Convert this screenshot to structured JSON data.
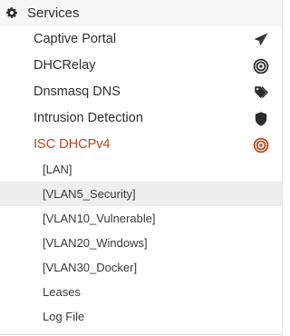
{
  "section": {
    "label": "Services",
    "icon": "gear-icon"
  },
  "items": [
    {
      "label": "Captive Portal",
      "icon": "paper-plane-icon"
    },
    {
      "label": "DHCRelay",
      "icon": "target-icon"
    },
    {
      "label": "Dnsmasq DNS",
      "icon": "tags-icon"
    },
    {
      "label": "Intrusion Detection",
      "icon": "shield-icon"
    },
    {
      "label": "ISC DHCPv4",
      "icon": "target-icon",
      "active": true
    }
  ],
  "subitems": [
    {
      "label": "[LAN]"
    },
    {
      "label": "[VLAN5_Security]",
      "highlight": true
    },
    {
      "label": "[VLAN10_Vulnerable]"
    },
    {
      "label": "[VLAN20_Windows]"
    },
    {
      "label": "[VLAN30_Docker]"
    },
    {
      "label": "Leases"
    },
    {
      "label": "Log File"
    }
  ],
  "colors": {
    "accent": "#c0471d",
    "text": "#2f2f2f",
    "icon": "#2d2d2d",
    "highlight_bg": "#eeeeee",
    "header_bg": "#f7f7f7"
  }
}
